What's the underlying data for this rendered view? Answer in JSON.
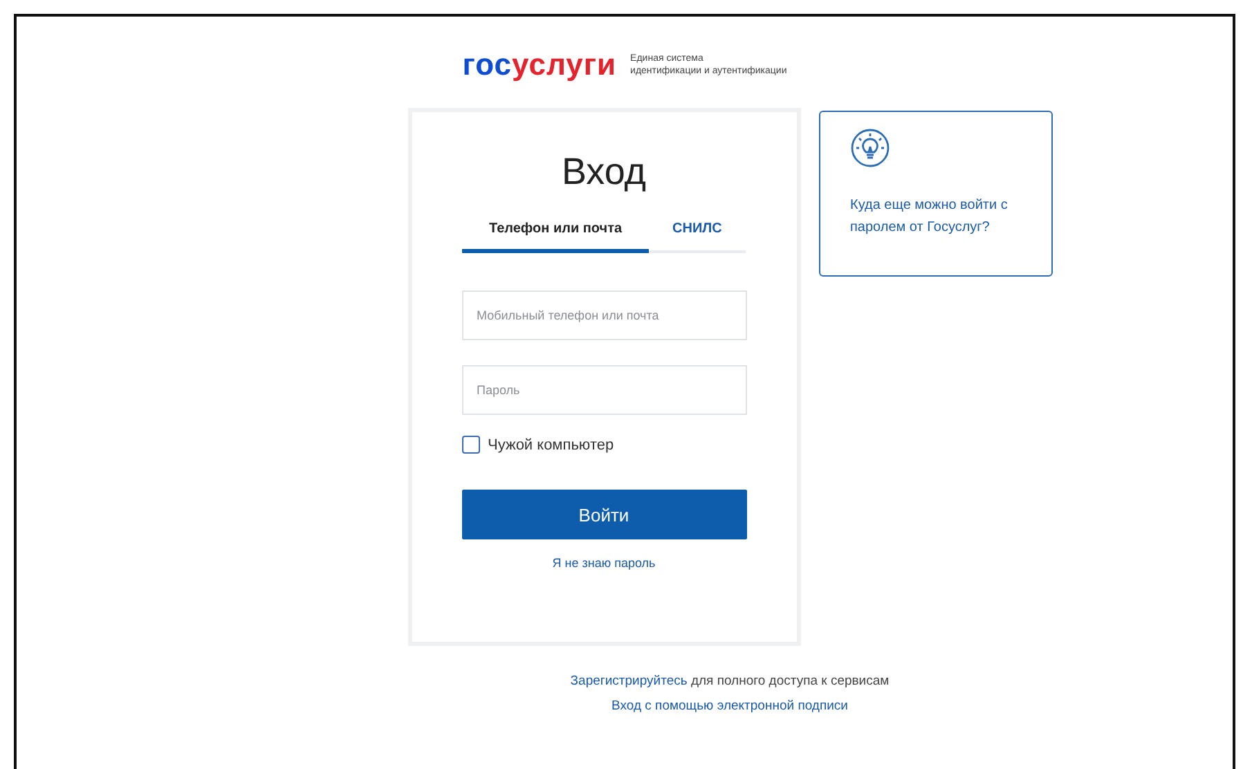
{
  "logo": {
    "part_1": "гос",
    "part_2": "услуги",
    "subtitle_line_1": "Единая система",
    "subtitle_line_2": "идентификации и аутентификации"
  },
  "login": {
    "title": "Вход",
    "tabs": [
      {
        "label": "Телефон или почта",
        "selected": true
      },
      {
        "label": "СНИЛС",
        "selected": false
      }
    ],
    "login_field": {
      "placeholder": "Мобильный телефон или почта"
    },
    "password_field": {
      "placeholder": "Пароль"
    },
    "foreign_computer": {
      "label": "Чужой компьютер",
      "checked": false
    },
    "submit": "Войти",
    "forgot_link": "Я не знаю пароль"
  },
  "info_card": {
    "text": "Куда еще можно войти с паролем от Госуслуг?"
  },
  "register": {
    "link": "Зарегистрируйтесь",
    "text": " для полного доступа к сервисам"
  },
  "signature_link": "Вход с помощью электронной подписи"
}
